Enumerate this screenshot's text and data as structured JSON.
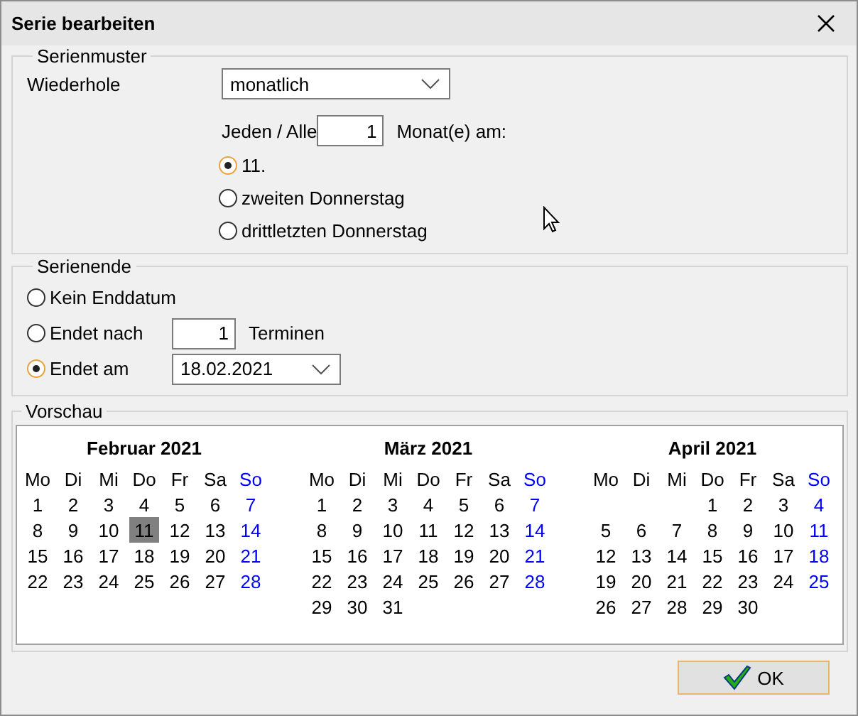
{
  "window": {
    "title": "Serie bearbeiten"
  },
  "pattern": {
    "legend": "Serienmuster",
    "repeat_label": "Wiederhole",
    "repeat_value": "monatlich",
    "every_label": "Jeden / Alle",
    "every_value": "1",
    "every_suffix": "Monat(e) am:",
    "options": [
      {
        "label": "11.",
        "selected": true
      },
      {
        "label": "zweiten Donnerstag",
        "selected": false
      },
      {
        "label": "drittletzten Donnerstag",
        "selected": false
      }
    ]
  },
  "end": {
    "legend": "Serienende",
    "options": [
      {
        "kind": "plain",
        "label": "Kein Enddatum",
        "selected": false
      },
      {
        "kind": "count",
        "label": "Endet nach",
        "value": "1",
        "suffix": "Terminen",
        "selected": false
      },
      {
        "kind": "date",
        "label": "Endet am",
        "value": "18.02.2021",
        "selected": true
      }
    ]
  },
  "preview": {
    "legend": "Vorschau",
    "months": [
      {
        "title": "Februar 2021",
        "weekdays": [
          {
            "label": "Mo",
            "color": "#000000"
          },
          {
            "label": "Di",
            "color": "#000000"
          },
          {
            "label": "Mi",
            "color": "#000000"
          },
          {
            "label": "Do",
            "color": "#000000"
          },
          {
            "label": "Fr",
            "color": "#000000"
          },
          {
            "label": "Sa",
            "color": "#000000"
          },
          {
            "label": "So",
            "color": "#0000ff"
          }
        ],
        "weeks": [
          {
            "kind": "full",
            "days": [
              {
                "day": "1",
                "marked": false
              },
              {
                "day": "2",
                "marked": false
              },
              {
                "day": "3",
                "marked": false
              },
              {
                "day": "4",
                "marked": false
              },
              {
                "day": "5",
                "marked": false
              },
              {
                "day": "6",
                "marked": false
              },
              {
                "day": "7",
                "marked": false
              }
            ]
          },
          {
            "kind": "full",
            "days": [
              {
                "day": "8",
                "marked": false
              },
              {
                "day": "9",
                "marked": false
              },
              {
                "day": "10",
                "marked": false
              },
              {
                "day": "11",
                "marked": true
              },
              {
                "day": "12",
                "marked": false
              },
              {
                "day": "13",
                "marked": false
              },
              {
                "day": "14",
                "marked": false
              }
            ]
          },
          {
            "kind": "full",
            "days": [
              {
                "day": "15",
                "marked": false
              },
              {
                "day": "16",
                "marked": false
              },
              {
                "day": "17",
                "marked": false
              },
              {
                "day": "18",
                "marked": false
              },
              {
                "day": "19",
                "marked": false
              },
              {
                "day": "20",
                "marked": false
              },
              {
                "day": "21",
                "marked": false
              }
            ]
          },
          {
            "kind": "full",
            "days": [
              {
                "day": "22",
                "marked": false
              },
              {
                "day": "23",
                "marked": false
              },
              {
                "day": "24",
                "marked": false
              },
              {
                "day": "25",
                "marked": false
              },
              {
                "day": "26",
                "marked": false
              },
              {
                "day": "27",
                "marked": false
              },
              {
                "day": "28",
                "marked": false
              }
            ]
          }
        ]
      },
      {
        "title": "März 2021",
        "weekdays": [
          {
            "label": "Mo",
            "color": "#000000"
          },
          {
            "label": "Di",
            "color": "#000000"
          },
          {
            "label": "Mi",
            "color": "#000000"
          },
          {
            "label": "Do",
            "color": "#000000"
          },
          {
            "label": "Fr",
            "color": "#000000"
          },
          {
            "label": "Sa",
            "color": "#000000"
          },
          {
            "label": "So",
            "color": "#0000ff"
          }
        ],
        "weeks": [
          {
            "kind": "full",
            "days": [
              {
                "day": "1",
                "marked": false
              },
              {
                "day": "2",
                "marked": false
              },
              {
                "day": "3",
                "marked": false
              },
              {
                "day": "4",
                "marked": false
              },
              {
                "day": "5",
                "marked": false
              },
              {
                "day": "6",
                "marked": false
              },
              {
                "day": "7",
                "marked": false
              }
            ]
          },
          {
            "kind": "full",
            "days": [
              {
                "day": "8",
                "marked": false
              },
              {
                "day": "9",
                "marked": false
              },
              {
                "day": "10",
                "marked": false
              },
              {
                "day": "11",
                "marked": false
              },
              {
                "day": "12",
                "marked": false
              },
              {
                "day": "13",
                "marked": false
              },
              {
                "day": "14",
                "marked": false
              }
            ]
          },
          {
            "kind": "full",
            "days": [
              {
                "day": "15",
                "marked": false
              },
              {
                "day": "16",
                "marked": false
              },
              {
                "day": "17",
                "marked": false
              },
              {
                "day": "18",
                "marked": false
              },
              {
                "day": "19",
                "marked": false
              },
              {
                "day": "20",
                "marked": false
              },
              {
                "day": "21",
                "marked": false
              }
            ]
          },
          {
            "kind": "full",
            "days": [
              {
                "day": "22",
                "marked": false
              },
              {
                "day": "23",
                "marked": false
              },
              {
                "day": "24",
                "marked": false
              },
              {
                "day": "25",
                "marked": false
              },
              {
                "day": "26",
                "marked": false
              },
              {
                "day": "27",
                "marked": false
              },
              {
                "day": "28",
                "marked": false
              }
            ]
          },
          {
            "kind": "last",
            "days": [
              {
                "day": "29",
                "marked": false
              },
              {
                "day": "30",
                "marked": false
              },
              {
                "day": "31",
                "marked": false
              }
            ]
          }
        ]
      },
      {
        "title": "April 2021",
        "weekdays": [
          {
            "label": "Mo",
            "color": "#000000"
          },
          {
            "label": "Di",
            "color": "#000000"
          },
          {
            "label": "Mi",
            "color": "#000000"
          },
          {
            "label": "Do",
            "color": "#000000"
          },
          {
            "label": "Fr",
            "color": "#000000"
          },
          {
            "label": "Sa",
            "color": "#000000"
          },
          {
            "label": "So",
            "color": "#0000ff"
          }
        ],
        "weeks": [
          {
            "kind": "first",
            "days": [
              {
                "day": "1",
                "marked": false
              },
              {
                "day": "2",
                "marked": false
              },
              {
                "day": "3",
                "marked": false
              },
              {
                "day": "4",
                "marked": false
              }
            ]
          },
          {
            "kind": "full",
            "days": [
              {
                "day": "5",
                "marked": false
              },
              {
                "day": "6",
                "marked": false
              },
              {
                "day": "7",
                "marked": false
              },
              {
                "day": "8",
                "marked": false
              },
              {
                "day": "9",
                "marked": false
              },
              {
                "day": "10",
                "marked": false
              },
              {
                "day": "11",
                "marked": false
              }
            ]
          },
          {
            "kind": "full",
            "days": [
              {
                "day": "12",
                "marked": false
              },
              {
                "day": "13",
                "marked": false
              },
              {
                "day": "14",
                "marked": false
              },
              {
                "day": "15",
                "marked": false
              },
              {
                "day": "16",
                "marked": false
              },
              {
                "day": "17",
                "marked": false
              },
              {
                "day": "18",
                "marked": false
              }
            ]
          },
          {
            "kind": "full",
            "days": [
              {
                "day": "19",
                "marked": false
              },
              {
                "day": "20",
                "marked": false
              },
              {
                "day": "21",
                "marked": false
              },
              {
                "day": "22",
                "marked": false
              },
              {
                "day": "23",
                "marked": false
              },
              {
                "day": "24",
                "marked": false
              },
              {
                "day": "25",
                "marked": false
              }
            ]
          },
          {
            "kind": "last",
            "days": [
              {
                "day": "26",
                "marked": false
              },
              {
                "day": "27",
                "marked": false
              },
              {
                "day": "28",
                "marked": false
              },
              {
                "day": "29",
                "marked": false
              },
              {
                "day": "30",
                "marked": false
              }
            ]
          }
        ]
      }
    ]
  },
  "buttons": [
    {
      "label": "OK"
    }
  ]
}
